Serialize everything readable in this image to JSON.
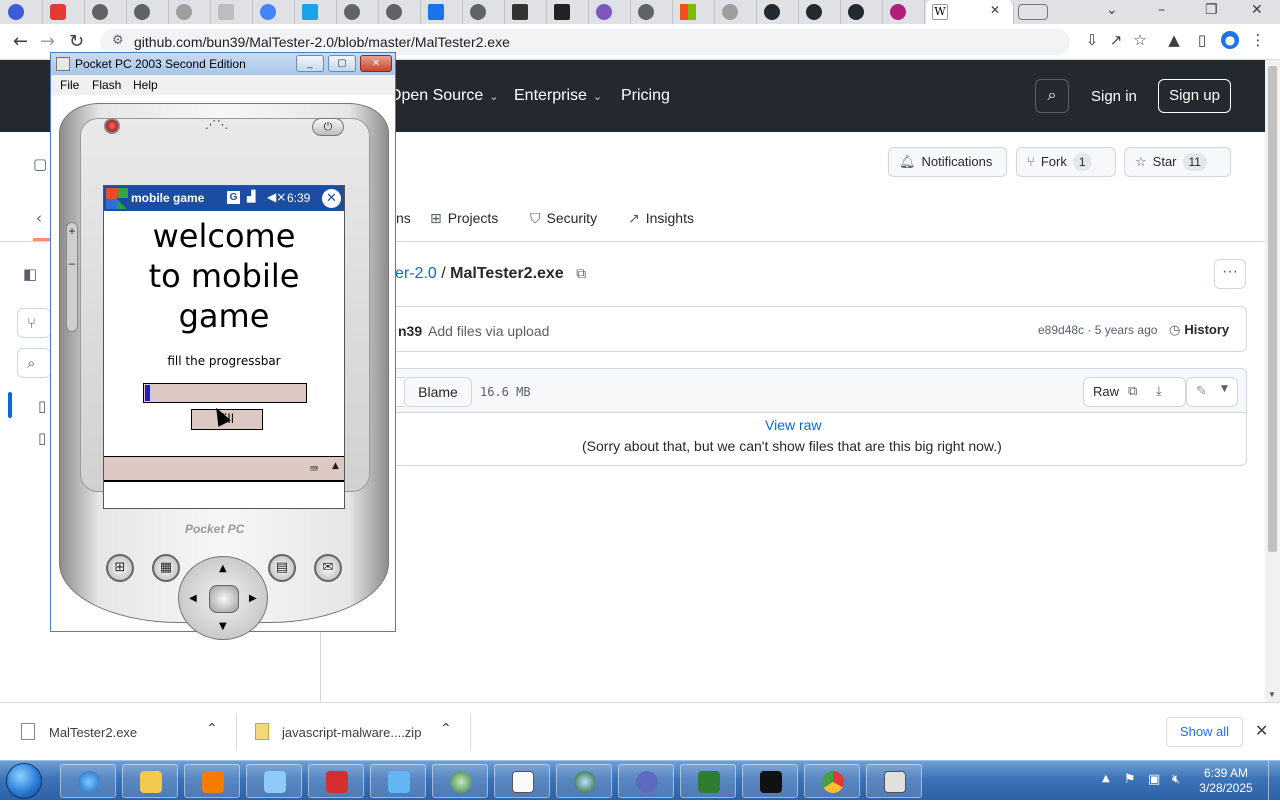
{
  "browser": {
    "url": "github.com/bun39/MalTester-2.0/blob/master/MalTester2.exe",
    "active_tab_close": "✕"
  },
  "github": {
    "nav": [
      "Open Source",
      "Enterprise",
      "Pricing"
    ],
    "sign_in": "Sign in",
    "sign_up": "Sign up",
    "notifications": "Notifications",
    "fork_label": "Fork",
    "fork_count": "1",
    "star_label": "Star",
    "star_count": "11",
    "repo_tabs": [
      "ns",
      "Projects",
      "Security",
      "Insights"
    ],
    "breadcrumb_repo": "er-2.0",
    "breadcrumb_sep": "/",
    "breadcrumb_file": "MalTester2.exe",
    "commit_author": "n39",
    "commit_message": "Add files via upload",
    "commit_meta": "e89d48c · 5 years ago",
    "history": "History",
    "blame": "Blame",
    "file_size": "16.6 MB",
    "raw": "Raw",
    "view_raw": "View raw",
    "sorry_message": "(Sorry about that, but we can't show files that are this big right now.)"
  },
  "emulator": {
    "title": "Pocket PC 2003 Second Edition",
    "menu": [
      "File",
      "Flash",
      "Help"
    ],
    "app_title": "mobile game",
    "time": "6:39",
    "welcome_lines": [
      "welcome",
      "to mobile",
      "game"
    ],
    "instruction": "fill the progressbar",
    "fill_button": "fill",
    "progress_fraction": 0.03,
    "logo": "Pocket PC"
  },
  "downloads": {
    "items": [
      "MalTester2.exe",
      "javascript-malware....zip"
    ],
    "show_all": "Show all"
  },
  "taskbar": {
    "time": "6:39 AM",
    "date": "3/28/2025"
  }
}
